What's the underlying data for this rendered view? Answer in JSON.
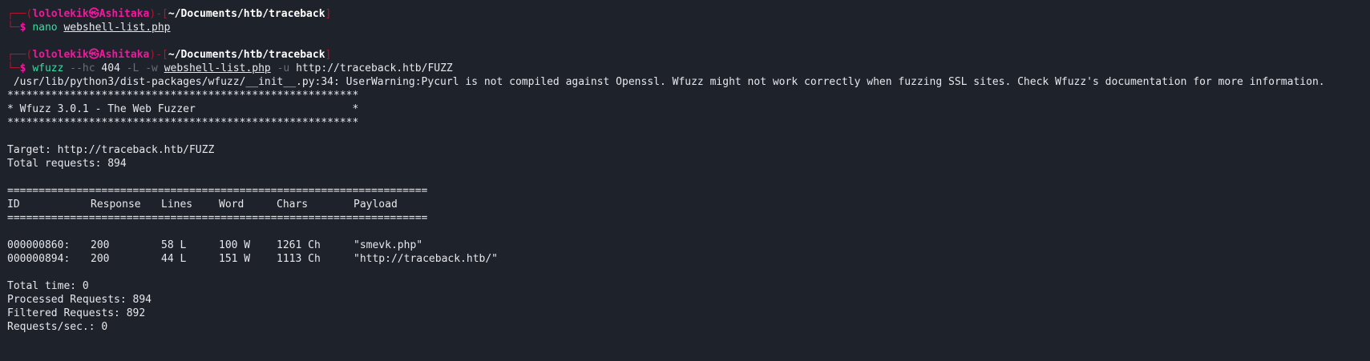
{
  "prompt1": {
    "corner_top": "┌──(",
    "user": "lololekik㉿Ashitaka",
    "sep": ")-[",
    "path": "~/Documents/htb/traceback",
    "close": "]",
    "corner_bottom": "└─",
    "dollar": "$",
    "command": "nano",
    "argument": "webshell-list.php"
  },
  "prompt2": {
    "corner_top": "┌──(",
    "user": "lololekik㉿Ashitaka",
    "sep": ")-[",
    "path": "~/Documents/htb/traceback",
    "close": "]",
    "corner_bottom": "└─",
    "dollar": "$",
    "command": "wfuzz",
    "opt_hc": "--hc",
    "hc_value": "404",
    "opt_L": "-L",
    "opt_w": "-w",
    "wordlist": "webshell-list.php",
    "opt_u": "-u",
    "url": "http://traceback.htb/FUZZ"
  },
  "output": {
    "warning": " /usr/lib/python3/dist-packages/wfuzz/__init__.py:34: UserWarning:Pycurl is not compiled against Openssl. Wfuzz might not work correctly when fuzzing SSL sites. Check Wfuzz's documentation for more information.",
    "stars": "********************************************************",
    "banner": "* Wfuzz 3.0.1 - The Web Fuzzer                         *",
    "target": "Target: http://traceback.htb/FUZZ",
    "total_requests": "Total requests: 894",
    "separator": "===================================================================",
    "columns": [
      "ID",
      "Response",
      "Lines",
      "Word",
      "Chars",
      "Payload"
    ],
    "rows": [
      [
        "000000860:",
        "200",
        "58 L",
        "100 W",
        "1261 Ch",
        "\"smevk.php\""
      ],
      [
        "000000894:",
        "200",
        "44 L",
        "151 W",
        "1113 Ch",
        "\"http://traceback.htb/\""
      ]
    ],
    "total_time": "Total time: 0",
    "processed": "Processed Requests: 894",
    "filtered": "Filtered Requests: 892",
    "rate": "Requests/sec.: 0"
  }
}
